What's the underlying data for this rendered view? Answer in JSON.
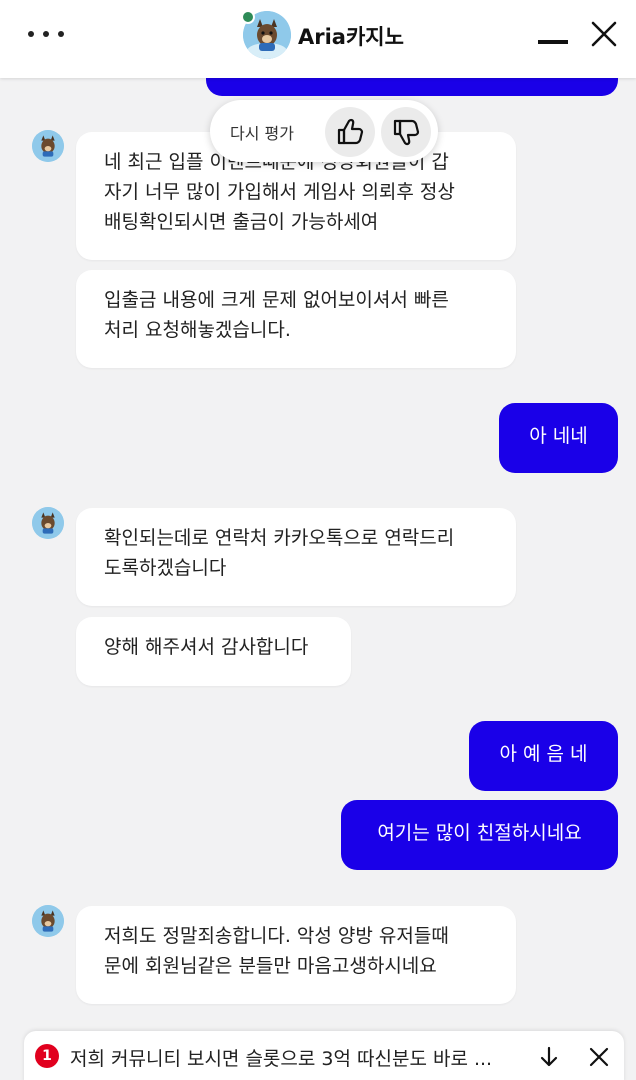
{
  "header": {
    "title": "Aria카지노",
    "menu_icon": "more-dots-icon",
    "minimize_icon": "minimize-icon",
    "close_icon": "close-icon"
  },
  "rating_popup": {
    "label": "다시 평가",
    "like_icon": "thumbs-up-icon",
    "dislike_icon": "thumbs-down-icon"
  },
  "messages": [
    {
      "from": "bot",
      "lines": [
        "네 최근 입플 이벤트때문에 정상회원들이 갑",
        "자기 너무 많이 가입해서 게임사 의뢰후 정상",
        "배팅확인되시면 출금이 가능하세여"
      ]
    },
    {
      "from": "bot",
      "lines": [
        "입출금 내용에 크게 문제 없어보이셔서 빠른",
        "처리 요청해놓겠습니다."
      ]
    },
    {
      "from": "user",
      "text": "아 네네"
    },
    {
      "from": "bot",
      "lines": [
        "확인되는데로 연락처 카카오톡으로 연락드리",
        "도록하겠습니다"
      ]
    },
    {
      "from": "bot",
      "lines": [
        "양해 해주셔서 감사합니다"
      ]
    },
    {
      "from": "user",
      "text": "아 예 음 네"
    },
    {
      "from": "user",
      "text": "여기는 많이 친절하시네요"
    },
    {
      "from": "bot",
      "lines": [
        "저희도 정말죄송합니다. 악성 양방 유저들때",
        "문에 회원님같은 분들만 마음고생하시네요"
      ]
    }
  ],
  "notification": {
    "count": "1",
    "text": "저희 커뮤니티 보시면 슬롯으로 3억 따신분도 바로 ...",
    "scroll_icon": "arrow-down-icon",
    "dismiss_icon": "close-icon"
  },
  "colors": {
    "accent": "#1a00e8",
    "bot_bubble": "#ffffff",
    "background": "#f2f2f3",
    "badge": "#e1001e"
  }
}
